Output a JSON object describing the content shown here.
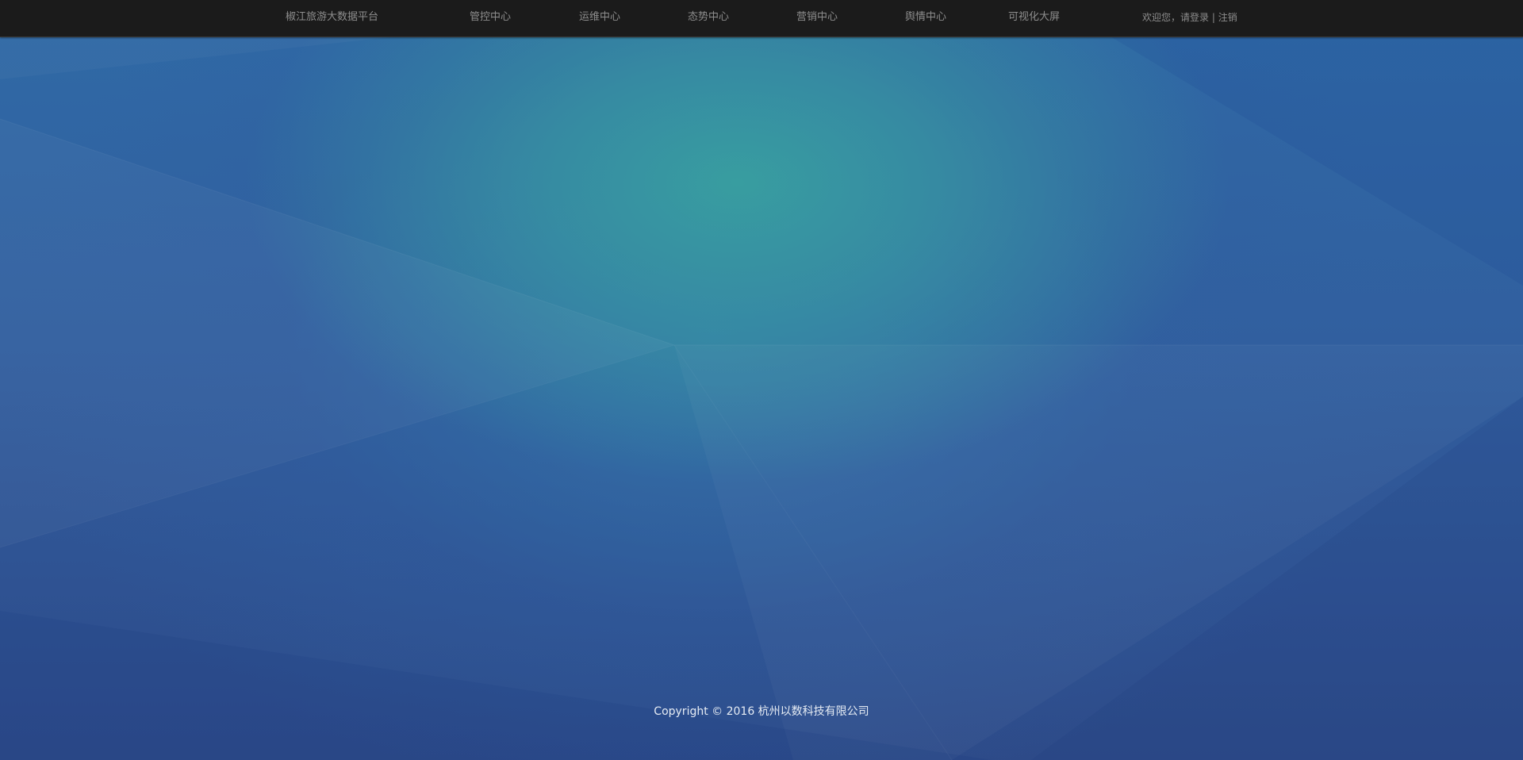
{
  "header": {
    "brand": "椒江旅游大数据平台",
    "nav": [
      {
        "label": "管控中心"
      },
      {
        "label": "运维中心"
      },
      {
        "label": "态势中心"
      },
      {
        "label": "营销中心"
      },
      {
        "label": "舆情中心"
      },
      {
        "label": "可视化大屏"
      }
    ],
    "user": {
      "welcome": "欢迎您，请登录",
      "separator": "|",
      "logout": "注销"
    }
  },
  "footer": {
    "copyright": "Copyright © 2016 杭州以数科技有限公司"
  },
  "colors": {
    "navbar": "#1b1b1b",
    "nav_text": "#8d8d8d",
    "bg_center": "#38a0a0",
    "bg_edge": "#2d4a88",
    "footer_text": "#e6ecf4"
  }
}
